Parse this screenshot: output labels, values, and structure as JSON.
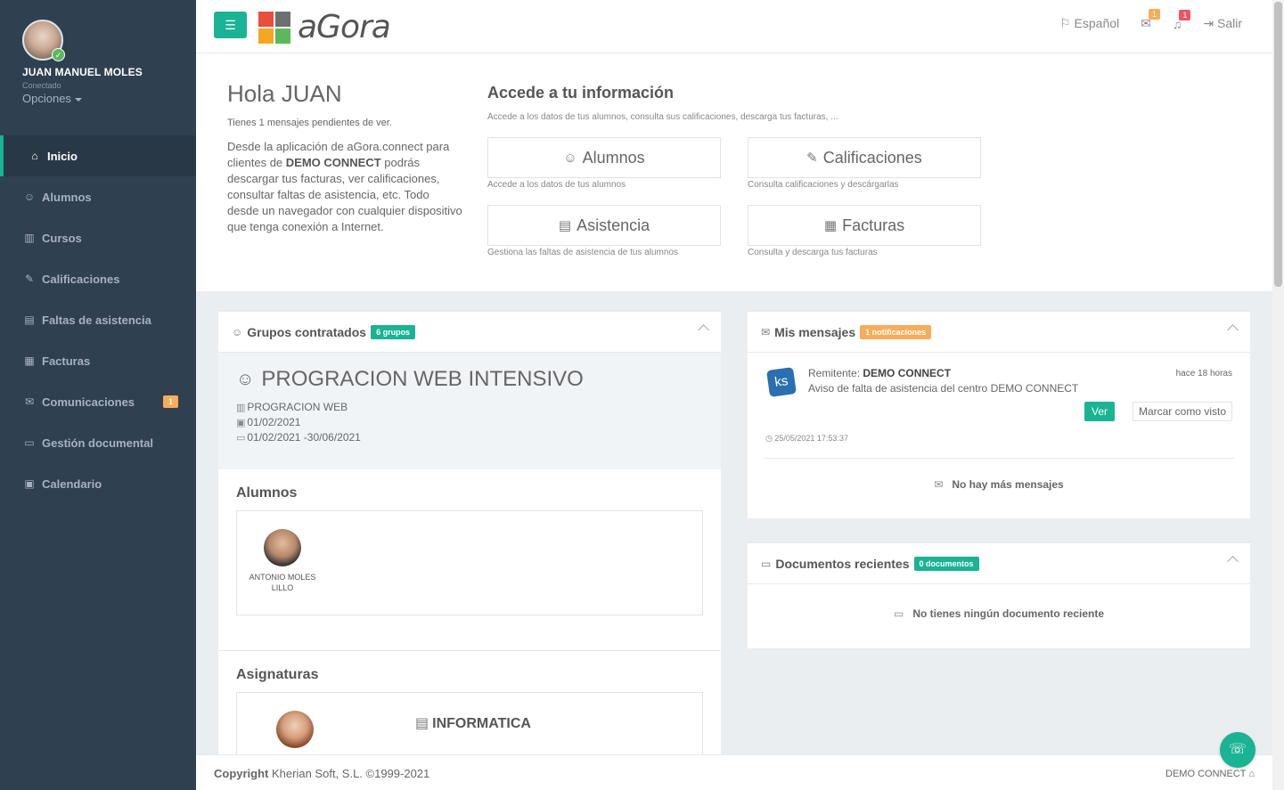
{
  "user": {
    "name": "JUAN MANUEL MOLES",
    "status": "Conectado",
    "options_label": "Opciones"
  },
  "sidebar": {
    "items": [
      {
        "label": "Inicio",
        "icon": "home-icon",
        "active": true
      },
      {
        "label": "Alumnos",
        "icon": "students-icon"
      },
      {
        "label": "Cursos",
        "icon": "books-icon"
      },
      {
        "label": "Calificaciones",
        "icon": "grades-icon"
      },
      {
        "label": "Faltas de asistencia",
        "icon": "attendance-icon"
      },
      {
        "label": "Facturas",
        "icon": "invoice-icon"
      },
      {
        "label": "Comunicaciones",
        "icon": "mail-icon",
        "badge": "1"
      },
      {
        "label": "Gestión documental",
        "icon": "folder-icon"
      },
      {
        "label": "Calendario",
        "icon": "calendar-icon"
      }
    ]
  },
  "topbar": {
    "logo_text": "aGora",
    "language": "Español",
    "mail_count": "1",
    "notif_count": "1",
    "logout": "Salir"
  },
  "hero": {
    "greeting": "Hola JUAN",
    "pending": "Tienes 1 mensajes pendientes de ver.",
    "desc_part1": "Desde la aplicación de aGora.connect para clientes de ",
    "desc_client": "DEMO CONNECT",
    "desc_part2": " podrás descargar tus facturas, ver calificaciones, consultar faltas de asistencia, etc. Todo desde un navegador con cualquier dispositivo que tenga conexión a Internet.",
    "access_title": "Accede a tu información",
    "access_sub": "Accede a los datos de tus alumnos, consulta sus calificaciones, descarga tus facturas, ...",
    "tiles": [
      {
        "label": "Alumnos",
        "caption": "Accede a los datos de tus alumnos"
      },
      {
        "label": "Calificaciones",
        "caption": "Consulta calificaciones y descárgarlas"
      },
      {
        "label": "Asistencia",
        "caption": "Gestiona las faltas de asistencia de tus alumnos"
      },
      {
        "label": "Facturas",
        "caption": "Consulta y descarga tus facturas"
      }
    ]
  },
  "groups": {
    "title": "Grupos contratados",
    "badge": "6 grupos",
    "group_name": "PROGRACION WEB INTENSIVO",
    "course": "PROGRACION WEB",
    "start": "01/02/2021",
    "range": "01/02/2021 -30/06/2021",
    "students_title": "Alumnos",
    "student_name": "ANTONIO MOLES LILLO",
    "subjects_title": "Asignaturas",
    "subject": "INFORMATICA"
  },
  "messages": {
    "title": "Mis mensajes",
    "badge": "1 notificaciones",
    "sender_label": "Remitente:",
    "sender": "DEMO CONNECT",
    "text": "Aviso de falta de asistencia del centro DEMO CONNECT",
    "ago": "hace 18 horas",
    "view": "Ver",
    "mark_seen": "Marcar como visto",
    "date": "25/05/2021 17:53:37",
    "no_more": "No hay más mensajes"
  },
  "documents": {
    "title": "Documentos recientes",
    "badge": "0 documentos",
    "empty": "No tienes ningún documento reciente"
  },
  "footer": {
    "copyright_label": "Copyright",
    "copyright_text": "Kherian Soft, S.L. ©1999-2021",
    "client": "DEMO CONNECT"
  },
  "colors": {
    "primary": "#1ab394",
    "warning": "#f8ac59",
    "danger": "#ed5565",
    "sidebar": "#2f4050"
  }
}
